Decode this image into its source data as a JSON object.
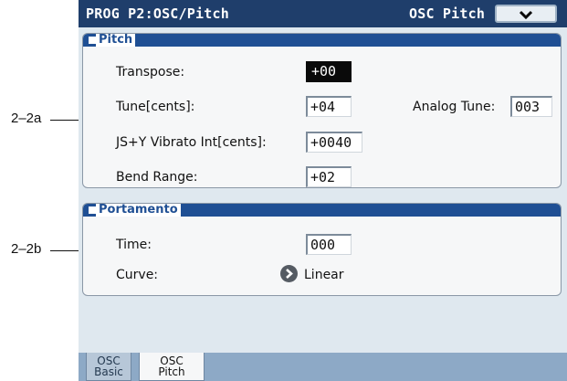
{
  "callouts": [
    "2–2a",
    "2–2b"
  ],
  "header": {
    "title": "PROG P2:OSC/Pitch",
    "page_label": "OSC Pitch"
  },
  "pitch": {
    "heading": "Pitch",
    "transpose_label": "Transpose:",
    "transpose_value": "+00",
    "tune_label": "Tune[cents]:",
    "tune_value": "+04",
    "analog_tune_label": "Analog Tune:",
    "analog_tune_value": "003",
    "js_label": "JS+Y Vibrato Int[cents]:",
    "js_value": "+0040",
    "bend_label": "Bend Range:",
    "bend_value": "+02"
  },
  "portamento": {
    "heading": "Portamento",
    "time_label": "Time:",
    "time_value": "000",
    "curve_label": "Curve:",
    "curve_value": "Linear"
  },
  "tabs": [
    {
      "line1": "OSC",
      "line2": "Basic"
    },
    {
      "line1": "OSC",
      "line2": "Pitch"
    }
  ],
  "colors": {
    "titlebar": "#1f3e6b",
    "section_header": "#1f4f94",
    "screen_bg": "#dfe8ef",
    "tabbar": "#8da9c6"
  },
  "icons": {
    "menu": "chevron-down-icon",
    "curve": "chevron-right-icon"
  }
}
